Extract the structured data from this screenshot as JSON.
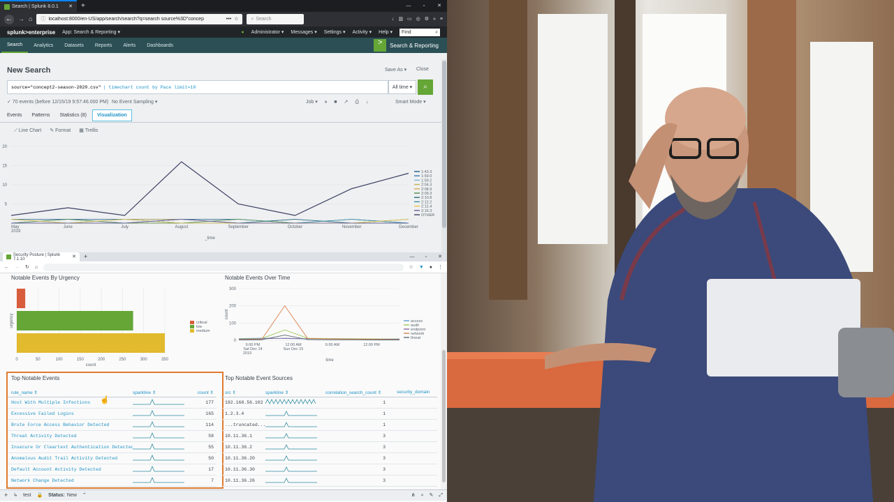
{
  "firefox": {
    "tab_title": "Search | Splunk 8.0.1",
    "url": "localhost:8000/en-US/app/search/search?q=search source%3D\"concep",
    "search_placeholder": "Search"
  },
  "splunk_bar": {
    "logo": "splunk>enterprise",
    "app_menu": "App: Search & Reporting ▾",
    "menus": [
      "Administrator ▾",
      "Messages ▾",
      "Settings ▾",
      "Activity ▾",
      "Help ▾"
    ],
    "find_placeholder": "Find"
  },
  "app_bar": {
    "nav": [
      "Search",
      "Analytics",
      "Datasets",
      "Reports",
      "Alerts",
      "Dashboards"
    ],
    "app_title": "Search & Reporting"
  },
  "search_page": {
    "title": "New Search",
    "save_as": "Save As ▾",
    "close": "Close",
    "query_source": "source=\"concept2-season-2020.csv\"",
    "query_cmd": "| timechart count by Pace limit=10",
    "time_range": "All time ▾",
    "event_count": "✓ 70 events (before 12/15/19 9:57:46.000 PM)",
    "sampling": "No Event Sampling ▾",
    "job": "Job ▾",
    "mode": "Smart Mode ▾",
    "tabs": [
      "Events",
      "Patterns",
      "Statistics (8)",
      "Visualization"
    ],
    "viz_options": [
      "Line Chart",
      "Format",
      "Trellis"
    ]
  },
  "chart_data": [
    {
      "type": "line",
      "title": "",
      "xlabel": "_time",
      "ylabel": "",
      "x": [
        "May 2019",
        "June",
        "July",
        "August",
        "September",
        "October",
        "November",
        "December"
      ],
      "ylim": [
        0,
        20
      ],
      "yticks": [
        5,
        10,
        15,
        20
      ],
      "legend_position": "right",
      "series": [
        {
          "name": "1:43.3",
          "color": "#1e5a8a",
          "values": [
            1,
            1,
            1,
            1,
            1,
            0,
            1,
            0
          ]
        },
        {
          "name": "1:59.0",
          "color": "#3a75b0",
          "values": [
            0,
            1,
            0,
            1,
            0,
            1,
            0,
            1
          ]
        },
        {
          "name": "1:59.2",
          "color": "#7fb4d6",
          "values": [
            1,
            0,
            1,
            0,
            1,
            0,
            1,
            0
          ]
        },
        {
          "name": "2:04.3",
          "color": "#c7b05c",
          "values": [
            0,
            0,
            1,
            1,
            0,
            0,
            0,
            1
          ]
        },
        {
          "name": "2:08.9",
          "color": "#d9a84a",
          "values": [
            1,
            0,
            0,
            0,
            0,
            0,
            0,
            0
          ]
        },
        {
          "name": "2:09.3",
          "color": "#4e8a4a",
          "values": [
            0,
            1,
            0,
            0,
            1,
            0,
            0,
            0
          ]
        },
        {
          "name": "2:10.8",
          "color": "#2d6b7c",
          "values": [
            0,
            0,
            0,
            1,
            0,
            1,
            0,
            0
          ]
        },
        {
          "name": "2:12.2",
          "color": "#3a8fa0",
          "values": [
            1,
            0,
            1,
            0,
            0,
            0,
            1,
            0
          ]
        },
        {
          "name": "2:12.4",
          "color": "#e6c34a",
          "values": [
            1,
            0,
            1,
            0,
            0,
            0,
            0,
            1
          ]
        },
        {
          "name": "2:16.3",
          "color": "#6c5a9a",
          "values": [
            0,
            0,
            0,
            1,
            0,
            0,
            0,
            0
          ]
        },
        {
          "name": "OTHER",
          "color": "#3b3f63",
          "values": [
            2,
            4,
            2,
            16,
            5,
            2,
            9,
            13
          ]
        }
      ]
    },
    {
      "type": "bar",
      "title": "Notable Events By Urgency",
      "orientation": "horizontal",
      "xlabel": "count",
      "ylabel": "urgency",
      "xlim": [
        0,
        350
      ],
      "xticks": [
        0,
        50,
        100,
        150,
        200,
        250,
        300,
        350
      ],
      "categories": [
        "critical",
        "low",
        "medium"
      ],
      "values": [
        20,
        275,
        350
      ],
      "colors": [
        "#d85d3c",
        "#65a637",
        "#e1ba2d"
      ],
      "legend_position": "right"
    },
    {
      "type": "line",
      "title": "Notable Events Over Time",
      "xlabel": "time",
      "ylabel": "count",
      "ylim": [
        0,
        300
      ],
      "yticks": [
        0,
        100,
        200,
        300
      ],
      "x": [
        "6:00 PM Sat Dec 14 2019",
        "12:00 AM Sun Dec 15",
        "6:00 AM",
        "12:00 PM"
      ],
      "legend_position": "right",
      "series": [
        {
          "name": "access",
          "color": "#5b9bd5",
          "values": [
            10,
            12,
            10,
            8,
            9,
            8,
            7,
            8
          ]
        },
        {
          "name": "audit",
          "color": "#a0c85a",
          "values": [
            8,
            10,
            60,
            12,
            10,
            9,
            8,
            7
          ]
        },
        {
          "name": "endpoint",
          "color": "#8d6a9f",
          "values": [
            6,
            8,
            12,
            9,
            8,
            7,
            6,
            6
          ]
        },
        {
          "name": "network",
          "color": "#d9814b",
          "values": [
            4,
            6,
            200,
            10,
            8,
            6,
            5,
            4
          ]
        },
        {
          "name": "threat",
          "color": "#5b6770",
          "values": [
            2,
            3,
            30,
            4,
            3,
            3,
            2,
            2
          ]
        }
      ]
    }
  ],
  "chrome": {
    "tab_title": "Security Posture | Splunk 7.1.10"
  },
  "top_events": {
    "title": "Top Notable Events",
    "headers": [
      "rule_name ⇕",
      "sparkline ⇕",
      "count ⇕"
    ],
    "rows": [
      {
        "rule": "Host With Multiple Infections",
        "count": "177"
      },
      {
        "rule": "Excessive Failed Logins",
        "count": "165"
      },
      {
        "rule": "Brute Force Access Behavior Detected",
        "count": "114"
      },
      {
        "rule": "Threat Activity Detected",
        "count": "58"
      },
      {
        "rule": "Insecure Or Cleartext Authentication Detected",
        "count": "55"
      },
      {
        "rule": "Anomalous Audit Trail Activity Detected",
        "count": "50"
      },
      {
        "rule": "Default Account Activity Detected",
        "count": "17"
      },
      {
        "rule": "Network Change Detected",
        "count": "7"
      }
    ]
  },
  "top_sources": {
    "title": "Top Notable Event Sources",
    "headers": [
      "src ⇕",
      "sparkline ⇕",
      "correlation_search_count ⇕",
      "security_domain"
    ],
    "rows": [
      {
        "src": "192.168.56.102",
        "count": "1"
      },
      {
        "src": "1.2.3.4",
        "count": "1"
      },
      {
        "src": "...truncated...",
        "count": "1"
      },
      {
        "src": "10.11.36.1",
        "count": "3"
      },
      {
        "src": "10.11.36.2",
        "count": "3"
      },
      {
        "src": "10.11.36.20",
        "count": "3"
      },
      {
        "src": "10.11.36.30",
        "count": "3"
      },
      {
        "src": "10.11.36.26",
        "count": "3"
      }
    ]
  },
  "status_bar": {
    "test": "test",
    "status_label": "Status:",
    "status_value": "New"
  }
}
